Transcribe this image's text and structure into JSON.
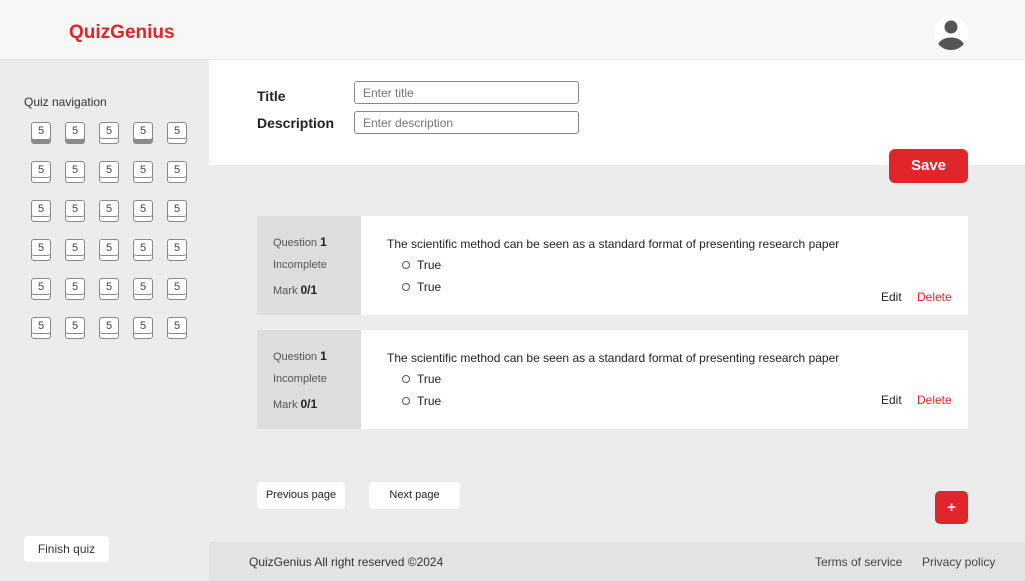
{
  "header": {
    "brand": "QuizGenius",
    "avatar_icon": "user-avatar-icon"
  },
  "sidebar": {
    "title": "Quiz navigation",
    "nav_items": [
      {
        "label": "5",
        "answered": true
      },
      {
        "label": "5",
        "answered": true
      },
      {
        "label": "5",
        "answered": false
      },
      {
        "label": "5",
        "answered": true
      },
      {
        "label": "5",
        "answered": false
      },
      {
        "label": "5",
        "answered": false
      },
      {
        "label": "5",
        "answered": false
      },
      {
        "label": "5",
        "answered": false
      },
      {
        "label": "5",
        "answered": false
      },
      {
        "label": "5",
        "answered": false
      },
      {
        "label": "5",
        "answered": false
      },
      {
        "label": "5",
        "answered": false
      },
      {
        "label": "5",
        "answered": false
      },
      {
        "label": "5",
        "answered": false
      },
      {
        "label": "5",
        "answered": false
      },
      {
        "label": "5",
        "answered": false
      },
      {
        "label": "5",
        "answered": false
      },
      {
        "label": "5",
        "answered": false
      },
      {
        "label": "5",
        "answered": false
      },
      {
        "label": "5",
        "answered": false
      },
      {
        "label": "5",
        "answered": false
      },
      {
        "label": "5",
        "answered": false
      },
      {
        "label": "5",
        "answered": false
      },
      {
        "label": "5",
        "answered": false
      },
      {
        "label": "5",
        "answered": false
      },
      {
        "label": "5",
        "answered": false
      },
      {
        "label": "5",
        "answered": false
      },
      {
        "label": "5",
        "answered": false
      },
      {
        "label": "5",
        "answered": false
      },
      {
        "label": "5",
        "answered": false
      }
    ],
    "finish_label": "Finish quiz"
  },
  "form": {
    "title_label": "Title",
    "title_placeholder": "Enter title",
    "description_label": "Description",
    "description_placeholder": "Enter description",
    "save_label": "Save"
  },
  "questions": [
    {
      "question_prefix": "Question ",
      "question_number": "1",
      "status": "Incomplete",
      "mark_prefix": "Mark ",
      "mark": "0/1",
      "text": "The scientific method can be seen as a standard format of presenting research paper",
      "options": [
        "True",
        "True"
      ],
      "edit_label": "Edit",
      "delete_label": "Delete"
    },
    {
      "question_prefix": "Question ",
      "question_number": "1",
      "status": "Incomplete",
      "mark_prefix": "Mark ",
      "mark": "0/1",
      "text": "The scientific method can be seen as a standard format of presenting research paper",
      "options": [
        "True",
        "True"
      ],
      "edit_label": "Edit",
      "delete_label": "Delete"
    }
  ],
  "pagination": {
    "previous_label": "Previous page",
    "next_label": "Next page"
  },
  "add_button": {
    "label": "+"
  },
  "footer": {
    "copyright": "QuizGenius All right reserved ©2024",
    "terms": "Terms of service",
    "privacy": "Privacy policy"
  },
  "colors": {
    "accent": "#e0262a",
    "sidebar_bg": "#ececec",
    "content_bg": "#ececec"
  }
}
